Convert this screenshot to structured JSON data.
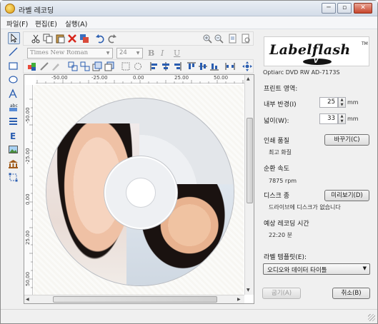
{
  "window": {
    "title": "라벨 레코딩",
    "minimize_glyph": "─",
    "maximize_glyph": "▫",
    "close_glyph": "✕"
  },
  "menu": {
    "file": "파일(F)",
    "edit": "편집(E)",
    "run": "실행(A)"
  },
  "formatting": {
    "font_name": "Times New Roman",
    "font_size": "24",
    "bold": "B",
    "italic": "I",
    "underline": "U"
  },
  "ruler": {
    "horizontal": [
      "-50.00",
      "-25.00",
      "0.00",
      "25.00",
      "50.00"
    ],
    "vertical": [
      "-50.00",
      "-25.00",
      "0.00",
      "25.00",
      "50.00"
    ]
  },
  "panel": {
    "logo": "Labelflash",
    "logo_tm": "TM",
    "logo_v": "V",
    "drive": "Optiarc DVD RW AD-7173S",
    "print_area_label": "프린트 영역:",
    "inner_radius_label": "내부 반경(I)",
    "inner_radius_value": "25",
    "inner_radius_unit": "mm",
    "width_label": "넓이(W):",
    "width_value": "33",
    "width_unit": "mm",
    "quality_label": "인쇄 품질",
    "quality_value": "최고 화질",
    "change_button": "바꾸기(C)",
    "speed_label": "순환 속도",
    "speed_value": "7875 rpm",
    "disc_type_label": "디스크 종",
    "disc_type_value": "드라이브에 디스크가 없습니다",
    "preview_button": "미리보기(D)",
    "time_label": "예상 레코딩 시간",
    "time_value": "22:20 분",
    "template_label": "라벨 템플릿(E):",
    "template_value": "오디오와 데이터 타이틀",
    "burn_button": "굽기(A)",
    "cancel_button": "취소(B)"
  },
  "colors": {
    "accent": "#6d8bb3",
    "close": "#c7452c"
  }
}
